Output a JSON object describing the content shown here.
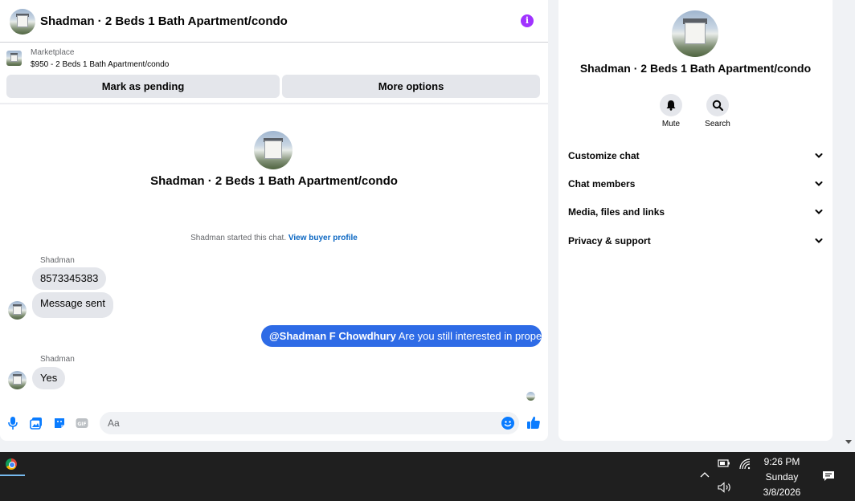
{
  "conversation": {
    "title": "Shadman · 2 Beds 1 Bath Apartment/condo"
  },
  "listing": {
    "label": "Marketplace",
    "price_title": "$950 - 2 Beds 1 Bath Apartment/condo"
  },
  "actions": {
    "mark_pending": "Mark as pending",
    "more_options": "More options"
  },
  "chat": {
    "intro_title": "Shadman · 2 Beds 1 Bath Apartment/condo",
    "started_text": "Shadman started this chat.",
    "buyer_profile_link": "View buyer profile",
    "messages": [
      {
        "sender": "Shadman",
        "text": "8573345383"
      },
      {
        "sender": "Shadman",
        "text": "Message sent"
      },
      {
        "sender": "me",
        "mention": "@Shadman F Chowdhury",
        "text": "Are you still interested in property ?"
      },
      {
        "sender": "Shadman",
        "text": "Yes"
      }
    ]
  },
  "composer": {
    "placeholder": "Aa",
    "icons": [
      "microphone-icon",
      "photo-icon",
      "sticker-icon",
      "gif-icon",
      "emoji-icon",
      "thumbs-up-icon"
    ],
    "gif_label": "GIF"
  },
  "info_panel": {
    "title": "Shadman · 2 Beds 1 Bath Apartment/condo",
    "mute_label": "Mute",
    "search_label": "Search",
    "sections": [
      "Customize chat",
      "Chat members",
      "Media, files and links",
      "Privacy & support"
    ]
  },
  "taskbar": {
    "time": "9:26 PM",
    "day": "Sunday",
    "date": "3/8/2026"
  },
  "colors": {
    "accent": "#2e6be6",
    "info_icon": "#a033ff",
    "bubble_in": "#e4e6eb"
  }
}
